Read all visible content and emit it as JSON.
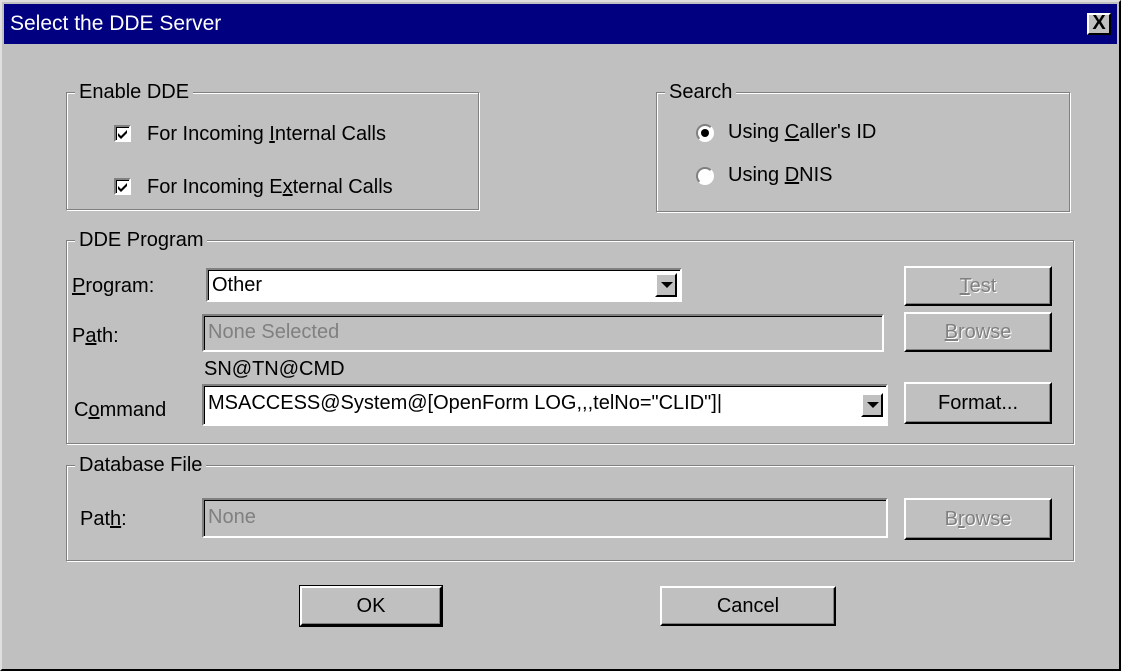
{
  "window": {
    "title": "Select the DDE Server",
    "close_label": "X"
  },
  "enable_dde": {
    "legend": "Enable DDE",
    "internal": {
      "prefix": "For Incoming ",
      "mnemonic": "I",
      "suffix": "nternal Calls",
      "checked": true
    },
    "external": {
      "prefix": "For Incoming E",
      "mnemonic": "x",
      "suffix": "ternal Calls",
      "checked": true
    }
  },
  "search": {
    "legend": "Search",
    "caller_id": {
      "prefix": "Using ",
      "mnemonic": "C",
      "suffix": "aller's ID",
      "selected": true
    },
    "dnis": {
      "prefix": "Using ",
      "mnemonic": "D",
      "suffix": "NIS",
      "selected": false
    }
  },
  "dde_program": {
    "legend": "DDE Program",
    "program_label": {
      "mnemonic": "P",
      "suffix": "rogram:"
    },
    "program_value": "Other",
    "path_label": {
      "prefix": "P",
      "mnemonic": "a",
      "suffix": "th:"
    },
    "path_value": "None Selected",
    "format_hint": "SN@TN@CMD",
    "command_label": {
      "prefix": "C",
      "mnemonic": "o",
      "suffix": "mmand"
    },
    "command_value": "MSACCESS@System@[OpenForm LOG,,,telNo=\"CLID\"]|",
    "test_button": {
      "mnemonic": "T",
      "suffix": "est"
    },
    "browse_button": {
      "mnemonic": "B",
      "suffix": "rowse"
    },
    "format_button": "Format..."
  },
  "database_file": {
    "legend": "Database File",
    "path_label": {
      "prefix": "Pat",
      "mnemonic": "h",
      "suffix": ":"
    },
    "path_value": "None",
    "browse_button": {
      "prefix": "B",
      "mnemonic": "r",
      "suffix": "owse"
    }
  },
  "footer": {
    "ok": "OK",
    "cancel": "Cancel"
  }
}
